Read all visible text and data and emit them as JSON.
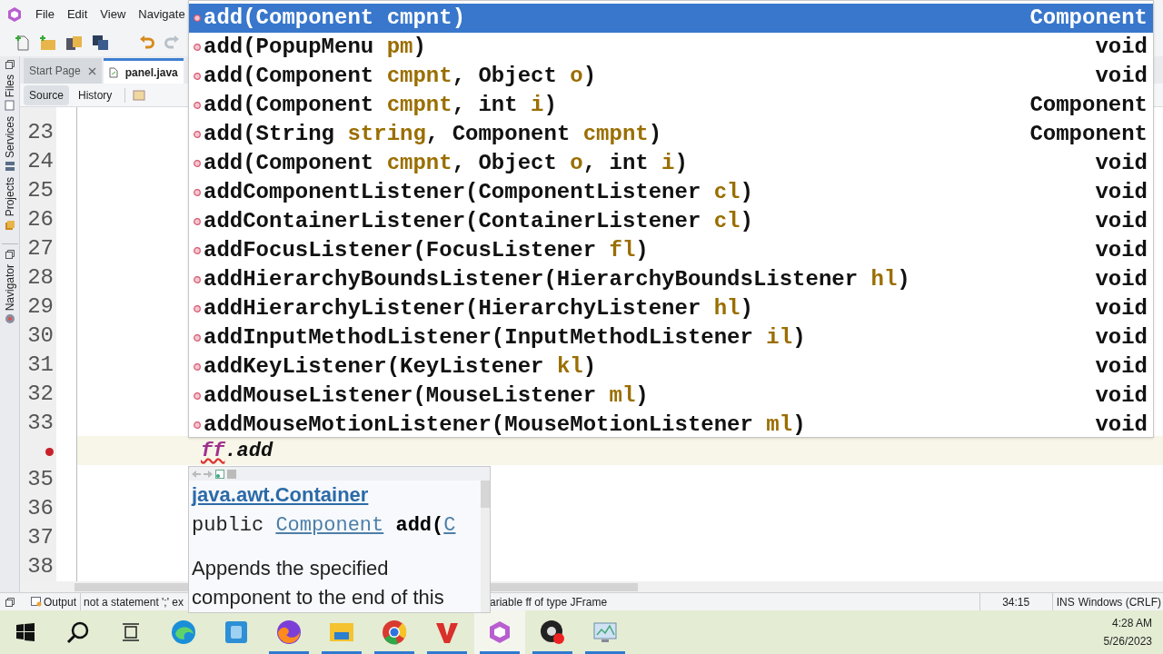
{
  "menu": [
    "File",
    "Edit",
    "View",
    "Navigate"
  ],
  "toolbar": [
    {
      "kind": "new-file",
      "disabled": false
    },
    {
      "kind": "new-project",
      "disabled": false
    },
    {
      "kind": "open-project",
      "disabled": false
    },
    {
      "kind": "save-all",
      "disabled": false
    },
    {
      "kind": "undo",
      "disabled": false
    },
    {
      "kind": "redo",
      "disabled": true
    }
  ],
  "editor_tabs": [
    {
      "label": "Start Page",
      "selected": false,
      "closable": true
    },
    {
      "label": "panel.java",
      "selected": true,
      "closable": false
    }
  ],
  "view_toggle": [
    {
      "label": "Source",
      "selected": true
    },
    {
      "label": "History",
      "selected": false
    }
  ],
  "side_tabs": [
    {
      "label": "Files",
      "kind": "files"
    },
    {
      "label": "Services",
      "kind": "services"
    },
    {
      "label": "Projects",
      "kind": "projects"
    },
    {
      "label": "Navigator",
      "kind": "navigator"
    }
  ],
  "lines": [
    {
      "kind": "plain",
      "number": "23"
    },
    {
      "kind": "plain",
      "number": "24"
    },
    {
      "kind": "plain",
      "number": "25"
    },
    {
      "kind": "plain",
      "number": "26"
    },
    {
      "kind": "plain",
      "number": "27"
    },
    {
      "kind": "plain",
      "number": "28"
    },
    {
      "kind": "plain",
      "number": "29"
    },
    {
      "kind": "plain",
      "number": "30"
    },
    {
      "kind": "plain",
      "number": "31"
    },
    {
      "kind": "plain",
      "number": "32"
    },
    {
      "kind": "plain",
      "number": "33"
    },
    {
      "kind": "error",
      "current": true,
      "code": [
        {
          "text": "ff",
          "kind": "field"
        },
        {
          "text": ".add",
          "kind": "typed"
        }
      ]
    },
    {
      "kind": "plain",
      "number": "35"
    },
    {
      "kind": "plain",
      "number": "36"
    },
    {
      "kind": "plain",
      "number": "37"
    },
    {
      "kind": "plain",
      "number": "38"
    }
  ],
  "completion": [
    {
      "selected": true,
      "parts": [
        {
          "text": "add(Component "
        },
        {
          "text": "cmpnt",
          "kind": "param"
        },
        {
          "text": ")"
        }
      ],
      "returns": "Component"
    },
    {
      "selected": false,
      "parts": [
        {
          "text": "add(PopupMenu "
        },
        {
          "text": "pm",
          "kind": "param"
        },
        {
          "text": ")"
        }
      ],
      "returns": "void"
    },
    {
      "selected": false,
      "parts": [
        {
          "text": "add(Component "
        },
        {
          "text": "cmpnt",
          "kind": "param"
        },
        {
          "text": ", Object "
        },
        {
          "text": "o",
          "kind": "param"
        },
        {
          "text": ")"
        }
      ],
      "returns": "void"
    },
    {
      "selected": false,
      "parts": [
        {
          "text": "add(Component "
        },
        {
          "text": "cmpnt",
          "kind": "param"
        },
        {
          "text": ", int "
        },
        {
          "text": "i",
          "kind": "param"
        },
        {
          "text": ")"
        }
      ],
      "returns": "Component"
    },
    {
      "selected": false,
      "parts": [
        {
          "text": "add(String "
        },
        {
          "text": "string",
          "kind": "param"
        },
        {
          "text": ", Component "
        },
        {
          "text": "cmpnt",
          "kind": "param"
        },
        {
          "text": ")"
        }
      ],
      "returns": "Component"
    },
    {
      "selected": false,
      "parts": [
        {
          "text": "add(Component "
        },
        {
          "text": "cmpnt",
          "kind": "param"
        },
        {
          "text": ", Object "
        },
        {
          "text": "o",
          "kind": "param"
        },
        {
          "text": ", int "
        },
        {
          "text": "i",
          "kind": "param"
        },
        {
          "text": ")"
        }
      ],
      "returns": "void"
    },
    {
      "selected": false,
      "parts": [
        {
          "text": "addComponentListener(ComponentListener "
        },
        {
          "text": "cl",
          "kind": "param"
        },
        {
          "text": ")"
        }
      ],
      "returns": "void"
    },
    {
      "selected": false,
      "parts": [
        {
          "text": "addContainerListener(ContainerListener "
        },
        {
          "text": "cl",
          "kind": "param"
        },
        {
          "text": ")"
        }
      ],
      "returns": "void"
    },
    {
      "selected": false,
      "parts": [
        {
          "text": "addFocusListener(FocusListener "
        },
        {
          "text": "fl",
          "kind": "param"
        },
        {
          "text": ")"
        }
      ],
      "returns": "void"
    },
    {
      "selected": false,
      "parts": [
        {
          "text": "addHierarchyBoundsListener(HierarchyBoundsListener "
        },
        {
          "text": "hl",
          "kind": "param"
        },
        {
          "text": ")"
        }
      ],
      "returns": "void"
    },
    {
      "selected": false,
      "parts": [
        {
          "text": "addHierarchyListener(HierarchyListener "
        },
        {
          "text": "hl",
          "kind": "param"
        },
        {
          "text": ")"
        }
      ],
      "returns": "void"
    },
    {
      "selected": false,
      "parts": [
        {
          "text": "addInputMethodListener(InputMethodListener "
        },
        {
          "text": "il",
          "kind": "param"
        },
        {
          "text": ")"
        }
      ],
      "returns": "void"
    },
    {
      "selected": false,
      "parts": [
        {
          "text": "addKeyListener(KeyListener "
        },
        {
          "text": "kl",
          "kind": "param"
        },
        {
          "text": ")"
        }
      ],
      "returns": "void"
    },
    {
      "selected": false,
      "parts": [
        {
          "text": "addMouseListener(MouseListener "
        },
        {
          "text": "ml",
          "kind": "param"
        },
        {
          "text": ")"
        }
      ],
      "returns": "void"
    },
    {
      "selected": false,
      "parts": [
        {
          "text": "addMouseMotionListener(MouseMotionListener "
        },
        {
          "text": "ml",
          "kind": "param"
        },
        {
          "text": ")"
        }
      ],
      "returns": "void"
    }
  ],
  "javadoc": {
    "class_link": "java.awt.Container",
    "signature": [
      {
        "text": "public ",
        "kind": "plain"
      },
      {
        "text": "Component",
        "kind": "link"
      },
      {
        "text": " add(",
        "kind": "bold"
      },
      {
        "text": "C",
        "kind": "link"
      }
    ],
    "description": [
      "Appends the specified",
      "component to the end of this"
    ]
  },
  "status_bar": {
    "output_tab": "Output",
    "message_left": "not a statement ';' ex",
    "message_right": "ariable ff of type JFrame",
    "position": "34:15",
    "mode": "INS",
    "line_endings": "Windows (CRLF)"
  },
  "taskbar": {
    "apps": [
      {
        "kind": "start",
        "running": false,
        "active": false
      },
      {
        "kind": "search",
        "running": false,
        "active": false
      },
      {
        "kind": "task-view",
        "running": false,
        "active": false
      },
      {
        "kind": "wave",
        "running": false,
        "active": false
      },
      {
        "kind": "photo",
        "running": false,
        "active": false
      },
      {
        "kind": "fox",
        "running": true,
        "active": false
      },
      {
        "kind": "folder",
        "running": true,
        "active": false
      },
      {
        "kind": "ring",
        "running": true,
        "active": false
      },
      {
        "kind": "letter-v",
        "running": true,
        "active": false
      },
      {
        "kind": "cube",
        "running": true,
        "active": true
      },
      {
        "kind": "record",
        "running": true,
        "active": false
      },
      {
        "kind": "monitor",
        "running": true,
        "active": false
      }
    ],
    "time": "4:28 AM",
    "date": "5/26/2023"
  }
}
